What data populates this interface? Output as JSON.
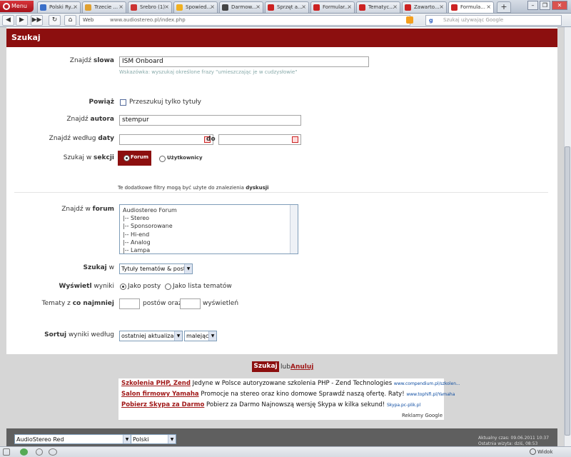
{
  "browser": {
    "menu_label": "Menu",
    "tabs": [
      {
        "label": "Polski Ry...",
        "color": "#3a6fc9",
        "active": false
      },
      {
        "label": "Trzecie ...",
        "color": "#e0a030",
        "active": false
      },
      {
        "label": "Srebro (1)",
        "color": "#c33",
        "active": false
      },
      {
        "label": "Spowied...",
        "color": "#f0b020",
        "active": false
      },
      {
        "label": "Darmow...",
        "color": "#444",
        "active": false
      },
      {
        "label": "Sprzęt a...",
        "color": "#c22",
        "active": false
      },
      {
        "label": "Formular...",
        "color": "#c22",
        "active": false
      },
      {
        "label": "Tematyc...",
        "color": "#c22",
        "active": false
      },
      {
        "label": "Zawarto...",
        "color": "#c22",
        "active": false
      },
      {
        "label": "Formula...",
        "color": "#c22",
        "active": true
      }
    ],
    "new_tab": "+",
    "url_prefix": "Web",
    "url": "www.audiostereo.pl/index.php",
    "search_placeholder": "Szukaj używając Google",
    "status_zoom": "Widok (100%)"
  },
  "page": {
    "title": "Szukaj",
    "find_words": {
      "label_pre": "Znajdź ",
      "label_b": "slowa",
      "value": "ISM Onboard",
      "hint": "Wskazówka: wyszukaj określone frazy \"umieszczając je w cudzysłowie\""
    },
    "link": {
      "label": "Powiąż",
      "checkbox_label": "Przeszukuj tylko tytuły"
    },
    "author": {
      "label_pre": "Znajdź ",
      "label_b": "autora",
      "value": "stempur"
    },
    "date": {
      "label_pre": "Znajdź według ",
      "label_b": "daty",
      "to": "do"
    },
    "section": {
      "label_pre": "Szukaj w ",
      "label_b": "sekcji",
      "opt_forum": "Forum",
      "opt_users": "Użytkownicy"
    },
    "filter_note": {
      "pre": "Te dodatkowe filtry mogą być użyte do znalezienia ",
      "b": "dyskusji"
    },
    "forum": {
      "label_pre": "Znajdź w ",
      "label_b": "forum",
      "items": [
        "Audiostereo Forum",
        "|-- Stereo",
        "|-- Sponsorowane",
        "|-- Hi-end",
        "|-- Analog",
        "|-- Lampa"
      ]
    },
    "search_in": {
      "label_b": "Szukaj",
      "label_post": " w",
      "value": "Tytuły tematów &  posty"
    },
    "display": {
      "label_b": "Wyświetl",
      "label_post": " wyniki",
      "opt_posts": "Jako posty",
      "opt_topics": "Jako lista tematów"
    },
    "topics_min": {
      "label_pre": "Tematy z ",
      "label_b": "co najmniej",
      "posts_text": "postów oraz",
      "views_text": "wyświetleń"
    },
    "sort": {
      "label_b": "Sortuj",
      "label_post": " wyniki według",
      "by": "ostatniej aktualizacji",
      "order": "malejąco"
    },
    "submit": "Szukaj",
    "or": "lub",
    "cancel": "Anuluj"
  },
  "ads": [
    {
      "title": "Szkolenia PHP, Zend",
      "text": " Jedyne w Polsce autoryzowane szkolenia PHP - Zend Technologies ",
      "url": "www.compendium.pl/szkolen..."
    },
    {
      "title": "Salon firmowy Yamaha",
      "text": " Promocje na stereo oraz kino domowe Sprawdź naszą ofertę. Raty! ",
      "url": "www.tophifi.pl/Yamaha"
    },
    {
      "title": "Pobierz Skypa za Darmo",
      "text": " Pobierz za Darmo Najnowszą wersję Skypa w kilka sekund! ",
      "url": "Skypa.pc-plik.pl"
    }
  ],
  "ads_credit": "Reklamy Google",
  "footer": {
    "style_select": "AudioStereo Red",
    "lang_select": "Polski",
    "time": "Aktualny czas: 09.06.2011 10:37",
    "last_visit": "Ostatnia wizyta: dziś, 08:53"
  }
}
